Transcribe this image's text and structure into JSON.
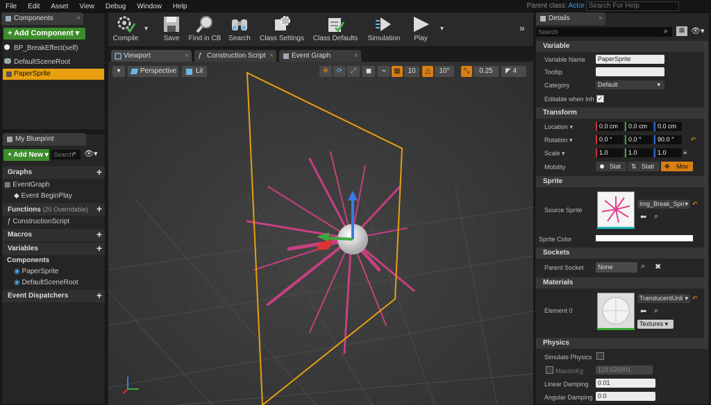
{
  "menu": [
    "File",
    "Edit",
    "Asset",
    "View",
    "Debug",
    "Window",
    "Help"
  ],
  "parent_class": {
    "label": "Parent class:",
    "value": "Actor"
  },
  "help_search_placeholder": "Search For Help",
  "components_panel": {
    "tab": "Components",
    "add_button": "+ Add Component ▾",
    "self_item": "BP_BreakEffect(self)",
    "tree": [
      "DefaultSceneRoot",
      "PaperSprite"
    ]
  },
  "toolbar": [
    "Compile",
    "Save",
    "Find in CB",
    "Search",
    "Class Settings",
    "Class Defaults",
    "Simulation",
    "Play"
  ],
  "editor_tabs": [
    "Viewport",
    "Construction Script",
    "Event Graph"
  ],
  "viewport": {
    "perspective": "Perspective",
    "lit": "Lit",
    "grid_snap": "10",
    "rot_snap": "10°",
    "scale_snap": "0.25",
    "cam_speed": "4"
  },
  "my_blueprint": {
    "tab": "My Blueprint",
    "add_new": "+ Add New ▾",
    "search_placeholder": "Search",
    "graphs": "Graphs",
    "event_graph": "EventGraph",
    "event_begin_play": "Event BeginPlay",
    "functions": "Functions",
    "functions_count": "(20 Overridable)",
    "construction_script": "ConstructionScript",
    "macros": "Macros",
    "variables": "Variables",
    "components": "Components",
    "comp_items": [
      "PaperSprite",
      "DefaultSceneRoot"
    ],
    "dispatchers": "Event Dispatchers"
  },
  "details": {
    "tab": "Details",
    "search_placeholder": "Search",
    "variable": {
      "title": "Variable",
      "name_label": "Variable Name",
      "name_value": "PaperSprite",
      "tooltip_label": "Tooltip",
      "tooltip_value": "",
      "category_label": "Category",
      "category_value": "Default",
      "editable_label": "Editable when Inh",
      "editable_checked": true
    },
    "transform": {
      "title": "Transform",
      "location_label": "Location ▾",
      "location": [
        "0.0 cm",
        "0.0 cm",
        "0.0 cm"
      ],
      "rotation_label": "Rotation ▾",
      "rotation": [
        "0.0 °",
        "0.0 °",
        "90.0 °"
      ],
      "scale_label": "Scale ▾",
      "scale": [
        "1.0",
        "1.0",
        "1.0"
      ],
      "mobility_label": "Mobility",
      "mobility": [
        "Stat",
        "Stati",
        "Mov"
      ]
    },
    "sprite": {
      "title": "Sprite",
      "source_label": "Source Sprite",
      "source_value": "Img_Break_Spri",
      "color_label": "Sprite Color"
    },
    "sockets": {
      "title": "Sockets",
      "parent_label": "Parent Socket",
      "parent_value": "None"
    },
    "materials": {
      "title": "Materials",
      "element_label": "Element 0",
      "element_value": "TranslucentUnli",
      "textures_label": "Textures ▾"
    },
    "physics": {
      "title": "Physics",
      "simulate_label": "Simulate Physics",
      "mass_label": "MassInKg",
      "mass_value": "129.526901",
      "linear_label": "Linear Damping",
      "linear_value": "0.01",
      "angular_label": "Angular Damping",
      "angular_value": "0.0"
    }
  },
  "colors": {
    "accent": "#d87e12",
    "green": "#3c8c2c",
    "selection": "#e8a010",
    "sprite_pink": "#e0408c"
  }
}
